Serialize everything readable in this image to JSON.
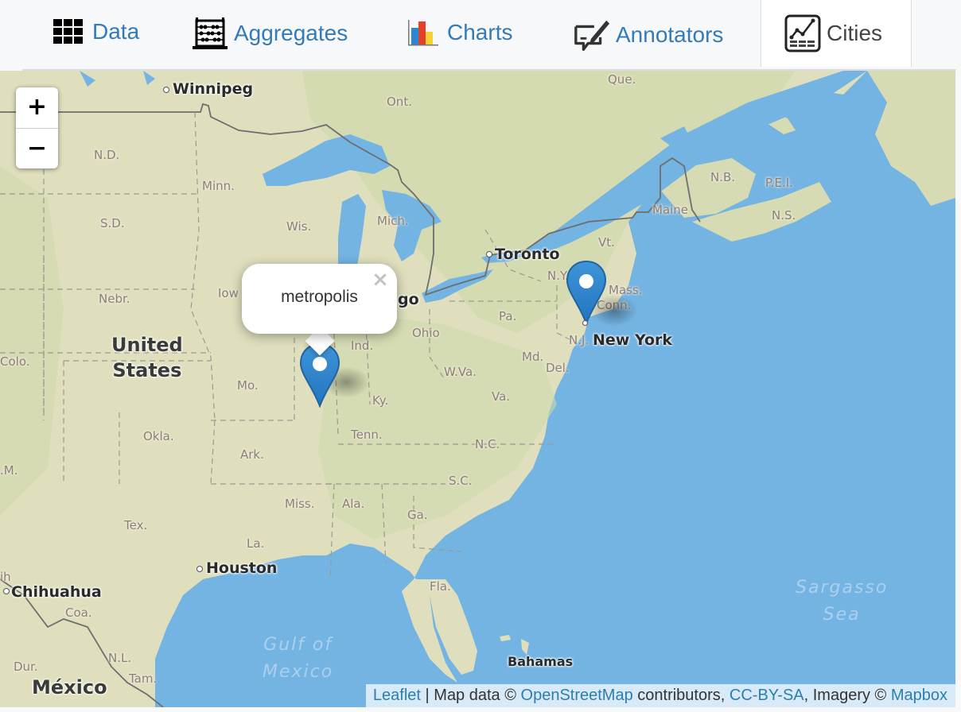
{
  "tabs": [
    {
      "id": "data",
      "label": "Data",
      "icon": "grid-icon",
      "active": false
    },
    {
      "id": "aggregates",
      "label": "Aggregates",
      "icon": "abacus-icon",
      "active": false
    },
    {
      "id": "charts",
      "label": "Charts",
      "icon": "bar-chart-icon",
      "active": false
    },
    {
      "id": "annotators",
      "label": "Annotators",
      "icon": "annotate-icon",
      "active": false
    },
    {
      "id": "cities",
      "label": "Cities",
      "icon": "line-chart-table-icon",
      "active": true
    }
  ],
  "colors": {
    "tab_link": "#337ab7",
    "tab_active_text": "#444444",
    "marker_blue": "#2e82cb",
    "water": "#74b4e2",
    "land": "#e3e2c4",
    "attribution_link": "#2a7fb0"
  },
  "map": {
    "zoom_in_label": "+",
    "zoom_out_label": "−",
    "popup": {
      "text": "metropolis",
      "close_label": "×"
    },
    "markers": [
      {
        "name": "metropolis",
        "has_popup": true
      },
      {
        "name": "new-york",
        "has_popup": false
      }
    ],
    "labels": {
      "cities": [
        "Winnipeg",
        "Toronto",
        "New York",
        "Houston",
        "Chihuahua",
        "Bahamas"
      ],
      "partial_city": "go",
      "countries": {
        "us_line1": "United",
        "us_line2": "States",
        "mexico": "México"
      },
      "states": {
        "que": "Que.",
        "ont": "Ont.",
        "nd": "N.D.",
        "minn": "Minn.",
        "sd": "S.D.",
        "wis": "Wis.",
        "mich": "Mich.",
        "nebr": "Nebr.",
        "iowa": "Iow",
        "colo": "Colo.",
        "mo": "Mo.",
        "ind": "Ind.",
        "ohio": "Ohio",
        "pa": "Pa.",
        "ny": "N.Y.",
        "mass": "Mass.",
        "conn": "Conn.",
        "nj": "N.J.",
        "vt": "Vt.",
        "maine": "Maine",
        "nb": "N.B.",
        "pei": "P.E.I.",
        "ns": "N.S.",
        "md": "Md.",
        "del": "Del.",
        "wva": "W.Va.",
        "va": "Va.",
        "ky": "Ky.",
        "tenn": "Tenn.",
        "nc": "N.C.",
        "sc": "S.C.",
        "okla": "Okla.",
        "ark": "Ark.",
        "nm": ".M.",
        "miss": "Miss.",
        "ala": "Ala.",
        "ga": "Ga.",
        "tex": "Tex.",
        "la": "La.",
        "fla": "Fla.",
        "coa": "Coa.",
        "nl": "N.L.",
        "dur": "Dur.",
        "tam": "Tam.",
        "chih": "ih"
      },
      "water": {
        "gulf_line1": "Gulf of",
        "gulf_line2": "Mexico",
        "sargasso_line1": "Sargasso",
        "sargasso_line2": "Sea"
      }
    },
    "attribution": {
      "leaflet": "Leaflet",
      "sep": " | Map data © ",
      "osm": "OpenStreetMap",
      "contrib": " contributors, ",
      "license": "CC-BY-SA",
      "imagery": ", Imagery © ",
      "mapbox": "Mapbox"
    }
  }
}
